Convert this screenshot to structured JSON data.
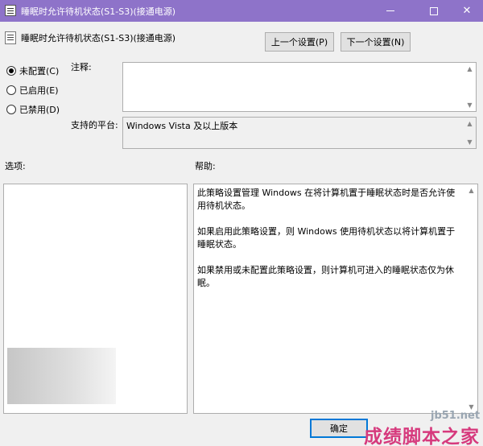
{
  "window": {
    "title": "睡眠时允许待机状态(S1-S3)(接通电源)"
  },
  "header": {
    "title": "睡眠时允许待机状态(S1-S3)(接通电源)",
    "prev_button": "上一个设置(P)",
    "next_button": "下一个设置(N)"
  },
  "state": {
    "options": [
      {
        "label": "未配置(C)",
        "checked": true
      },
      {
        "label": "已启用(E)",
        "checked": false
      },
      {
        "label": "已禁用(D)",
        "checked": false
      }
    ]
  },
  "comment": {
    "label": "注释:",
    "value": ""
  },
  "platform": {
    "label": "支持的平台:",
    "value": "Windows Vista 及以上版本"
  },
  "options_panel": {
    "label": "选项:"
  },
  "help_panel": {
    "label": "帮助:",
    "paragraphs": [
      "此策略设置管理 Windows 在将计算机置于睡眠状态时是否允许使用待机状态。",
      "如果启用此策略设置，则 Windows 使用待机状态以将计算机置于睡眠状态。",
      "如果禁用或未配置此策略设置，则计算机可进入的睡眠状态仅为休眠。"
    ]
  },
  "footer": {
    "ok_button": "确定"
  },
  "watermark": {
    "site": "jb51.net",
    "brand": "成绩脚本之家"
  },
  "colors": {
    "titlebar": "#8e73c9",
    "dialog_bg": "#f0f0f0",
    "ok_border": "#0078d7"
  }
}
